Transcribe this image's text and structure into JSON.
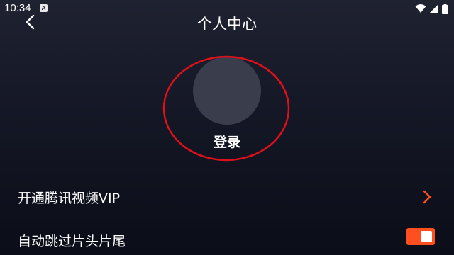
{
  "status_bar": {
    "time": "10:34",
    "notification_icon": "A"
  },
  "header": {
    "title": "个人中心"
  },
  "login": {
    "label": "登录"
  },
  "menu": {
    "vip_label": "开通腾讯视频VIP",
    "skip_label": "自动跳过片头片尾",
    "skip_enabled": true
  },
  "colors": {
    "accent": "#ff4f1f",
    "annotation": "#e0101a",
    "avatar": "#3a3d4c"
  },
  "icons": {
    "back": "chevron-left-icon",
    "vip_arrow": "chevron-right-icon",
    "wifi": "wifi-icon",
    "signal": "signal-icon",
    "battery": "battery-icon"
  }
}
